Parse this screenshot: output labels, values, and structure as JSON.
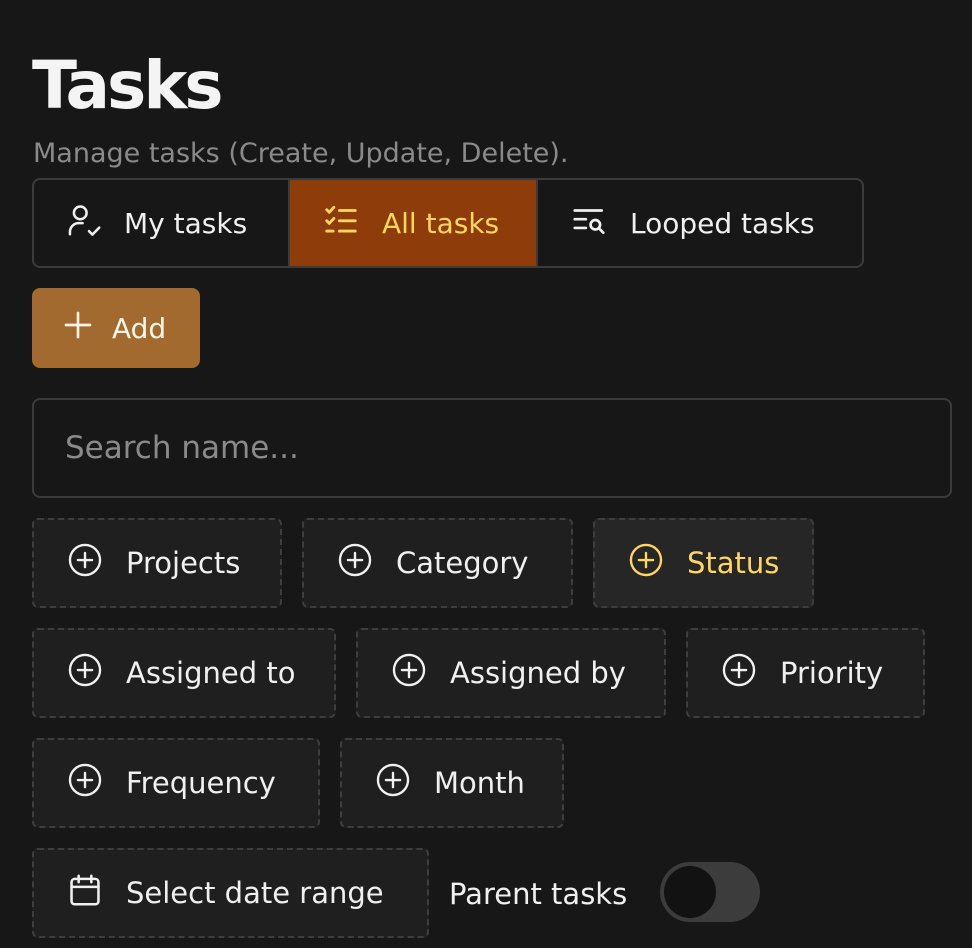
{
  "header": {
    "title": "Tasks",
    "subtitle": "Manage tasks (Create, Update, Delete)."
  },
  "tabs": [
    {
      "label": "My tasks",
      "icon": "user-check-icon",
      "active": false
    },
    {
      "label": "All tasks",
      "icon": "list-checks-icon",
      "active": true
    },
    {
      "label": "Looped tasks",
      "icon": "list-search-icon",
      "active": false
    }
  ],
  "add_button": {
    "label": "Add",
    "icon": "plus-icon"
  },
  "search": {
    "placeholder": "Search name...",
    "value": ""
  },
  "filters": [
    {
      "label": "Projects",
      "icon": "plus-circle-icon"
    },
    {
      "label": "Category",
      "icon": "plus-circle-icon"
    },
    {
      "label": "Status",
      "icon": "plus-circle-icon",
      "highlighted": true
    },
    {
      "label": "Assigned to",
      "icon": "plus-circle-icon"
    },
    {
      "label": "Assigned by",
      "icon": "plus-circle-icon"
    },
    {
      "label": "Priority",
      "icon": "plus-circle-icon"
    },
    {
      "label": "Frequency",
      "icon": "plus-circle-icon"
    },
    {
      "label": "Month",
      "icon": "plus-circle-icon"
    }
  ],
  "date_range": {
    "label": "Select date range",
    "icon": "calendar-icon"
  },
  "parent_tasks": {
    "label": "Parent tasks",
    "enabled": false
  },
  "colors": {
    "background": "#171717",
    "active_tab_bg": "#8e3c0a",
    "active_text": "#ffd75e",
    "add_button_bg": "#a26a2e",
    "border": "#3b3b3b"
  }
}
